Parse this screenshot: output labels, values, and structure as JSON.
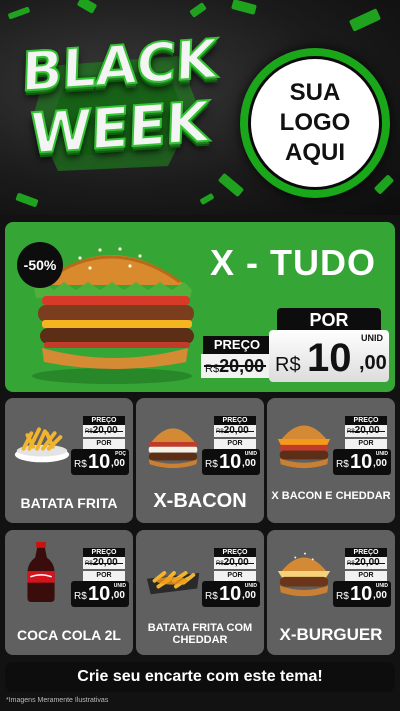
{
  "header": {
    "title_line1": "BLACK",
    "title_line2": "WEEK",
    "logo_lines": [
      "SUA",
      "LOGO",
      "AQUI"
    ]
  },
  "hero": {
    "discount": "-50%",
    "title": "X - TUDO",
    "preco_label": "PREÇO",
    "old_currency": "R$",
    "old_price": "20,00",
    "por_label": "POR",
    "unid_label": "UNID",
    "currency": "R$",
    "price_int": "10",
    "price_dec": ",00",
    "image": "burger-photo"
  },
  "products": [
    {
      "name": "BATATA FRITA",
      "image": "fries-bowl",
      "preco_label": "PREÇO",
      "old_currency": "R$",
      "old_price": "20,00",
      "por_label": "POR",
      "unid_label": "POÇ",
      "currency": "R$",
      "price_int": "10",
      "price_dec": ",00"
    },
    {
      "name": "X-BACON",
      "image": "bacon-burger",
      "preco_label": "PREÇO",
      "old_currency": "R$",
      "old_price": "20,00",
      "por_label": "POR",
      "unid_label": "UNID",
      "currency": "R$",
      "price_int": "10",
      "price_dec": ",00"
    },
    {
      "name": "X BACON E CHEDDAR",
      "image": "cheddar-burger",
      "preco_label": "PREÇO",
      "old_currency": "R$",
      "old_price": "20,00",
      "por_label": "POR",
      "unid_label": "UNID",
      "currency": "R$",
      "price_int": "10",
      "price_dec": ",00"
    },
    {
      "name": "COCA COLA 2L",
      "image": "soda-bottle",
      "preco_label": "PREÇO",
      "old_currency": "R$",
      "old_price": "20,00",
      "por_label": "POR",
      "unid_label": "UNID",
      "currency": "R$",
      "price_int": "10",
      "price_dec": ",00"
    },
    {
      "name": "BATATA FRITA COM CHEDDAR",
      "image": "fries-cheddar-tray",
      "preco_label": "PREÇO",
      "old_currency": "R$",
      "old_price": "20,00",
      "por_label": "POR",
      "unid_label": "UNID",
      "currency": "R$",
      "price_int": "10",
      "price_dec": ",00"
    },
    {
      "name": "X-BURGUER",
      "image": "cheese-burger",
      "preco_label": "PREÇO",
      "old_currency": "R$",
      "old_price": "20,00",
      "por_label": "POR",
      "unid_label": "UNID",
      "currency": "R$",
      "price_int": "10",
      "price_dec": ",00"
    }
  ],
  "footer": {
    "cta": "Crie seu encarte com este tema!",
    "disclaimer": "*Imagens Meramente Ilustrativas"
  },
  "colors": {
    "accent_green": "#35a535",
    "card_gray": "#606060",
    "dark": "#0d0d0d"
  }
}
